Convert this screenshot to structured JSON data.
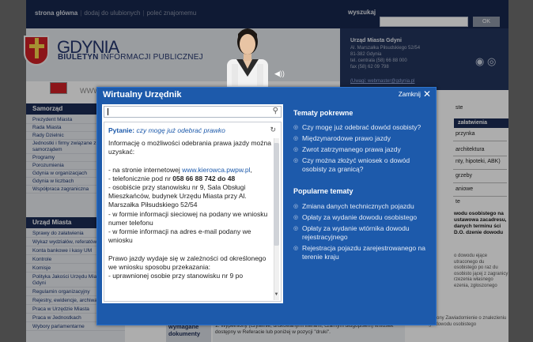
{
  "site": {
    "topnav": [
      "strona główna",
      "dodaj do ulubionych",
      "poleć znajomemu"
    ],
    "search_label": "wyszukaj",
    "ok_label": "OK",
    "logo_title": "GDYNIA",
    "logo_sub_bold": "BIULETYN",
    "logo_sub_rest": " INFORMACJI PUBLICZNEJ",
    "contact": {
      "title": "Urząd Miasta Gdyni",
      "lines": [
        "Al. Marszałka Piłsudskiego 52/54",
        "81-382 Gdynia",
        "tel. centrala (58) 66 88 000",
        "fax (58) 62 09 798"
      ],
      "link": "(Uwagi: webmaster@gdynia.pl"
    },
    "www": "WWW",
    "sidebar": {
      "head1": "Samorząd",
      "items1": [
        "Prezydent Miasta",
        "Rada Miasta",
        "Rady Dzielnic",
        "Jednostki i firmy związane z",
        "samorządem",
        "Programy",
        "Porozumienia",
        "Gdynia w organizacjach",
        "Gdynia w liczbach",
        "Współpraca zagraniczna"
      ],
      "head2": "Urząd Miasta",
      "items2": [
        "Sprawy do załatwienia",
        "Wykaz wydziałów, referatów",
        "Konta bankowe i kasy UM",
        "Kontrole",
        "Komisje",
        "Polityka Jakości Urzędu Miasta",
        "Gdyni",
        "Regulamin organizacyjny",
        "Rejestry, ewidencje, archiwa",
        "Praca w Urzędzie Miasta",
        "Praca w Jednostkach",
        "Wybory parlamentarne"
      ]
    },
    "right": {
      "top": "ste",
      "zalat": "załatwienia",
      "items": [
        "przynka",
        "architektura",
        "nty, hipoteki, ABK)",
        "grzeby",
        "aniowe",
        "te"
      ],
      "block": "wodu osobistego na ustawowa zacadresu, danych terminu ści D.O. dzenie dowodu",
      "small": "o dowodu ejące utraconego du osobistego po raz du osobisto jącej z zagranicy rzezenia własnego ezenia, zgłoszonego"
    },
    "bottom_label": "wymagane dokumenty",
    "bottom_text": "1. Wypełniony (czytelnie, drukowanymi literami, czarnym długopisem) wniosek dostępny w Referacie lub poniżej w pozycji \"druki\".",
    "bottom_right": "jako utracony Zawiadomienie o znalezieniu cudzego dowodu osobistego"
  },
  "modal": {
    "title": "Wirtualny Urzędnik",
    "close_label": "Zamknij",
    "input_value": "",
    "question_prefix": "Pytanie:",
    "question_text": "czy mogę już odebrać prawko",
    "answer_parts": [
      {
        "t": "Informację o możliwości odebrania prawa jazdy można uzyskać:\n\n- na stronie internetowej ",
        "c": ""
      },
      {
        "t": "www.kierowca.pwpw.pl",
        "c": "blue"
      },
      {
        "t": ",\n- telefonicznie pod nr ",
        "c": ""
      },
      {
        "t": "058 66 88 742 do 48",
        "c": "bold"
      },
      {
        "t": "\n- osobiście przy stanowisku nr 9, Sala Obsługi Mieszkańców, budynek Urzędu Miasta przy Al. Marszałka Piłsudskiego 52/54\n- w formie informacji sieciowej na podany we wniosku numer telefonu\n- w formie informacji na adres e-mail podany we wniosku\n\nPrawo jazdy wydaje się w zależności od określonego we wniosku sposobu przekazania:\n- uprawnionej osobie przy stanowisku nr 9 po",
        "c": ""
      }
    ],
    "related_title": "Tematy pokrewne",
    "related": [
      "Czy mogę już odebrać dowód osobisty?",
      "Międzynarodowe prawo jazdy",
      "Zwrot zatrzymanego prawa jazdy",
      "Czy można złożyć wniosek o dowód osobisty za granicą?"
    ],
    "popular_title": "Popularne tematy",
    "popular": [
      "Zmiana danych technicznych pojazdu",
      "Opłaty za wydanie dowodu osobistego",
      "Opłaty za wydanie wtórnika dowodu rejestracyjnego",
      "Rejestracja pojazdu zarejestrowanego na terenie kraju"
    ]
  },
  "colors": {
    "modal_bg": "#1d5aab",
    "navy": "#17274d",
    "link_blue": "#1d5aab"
  }
}
